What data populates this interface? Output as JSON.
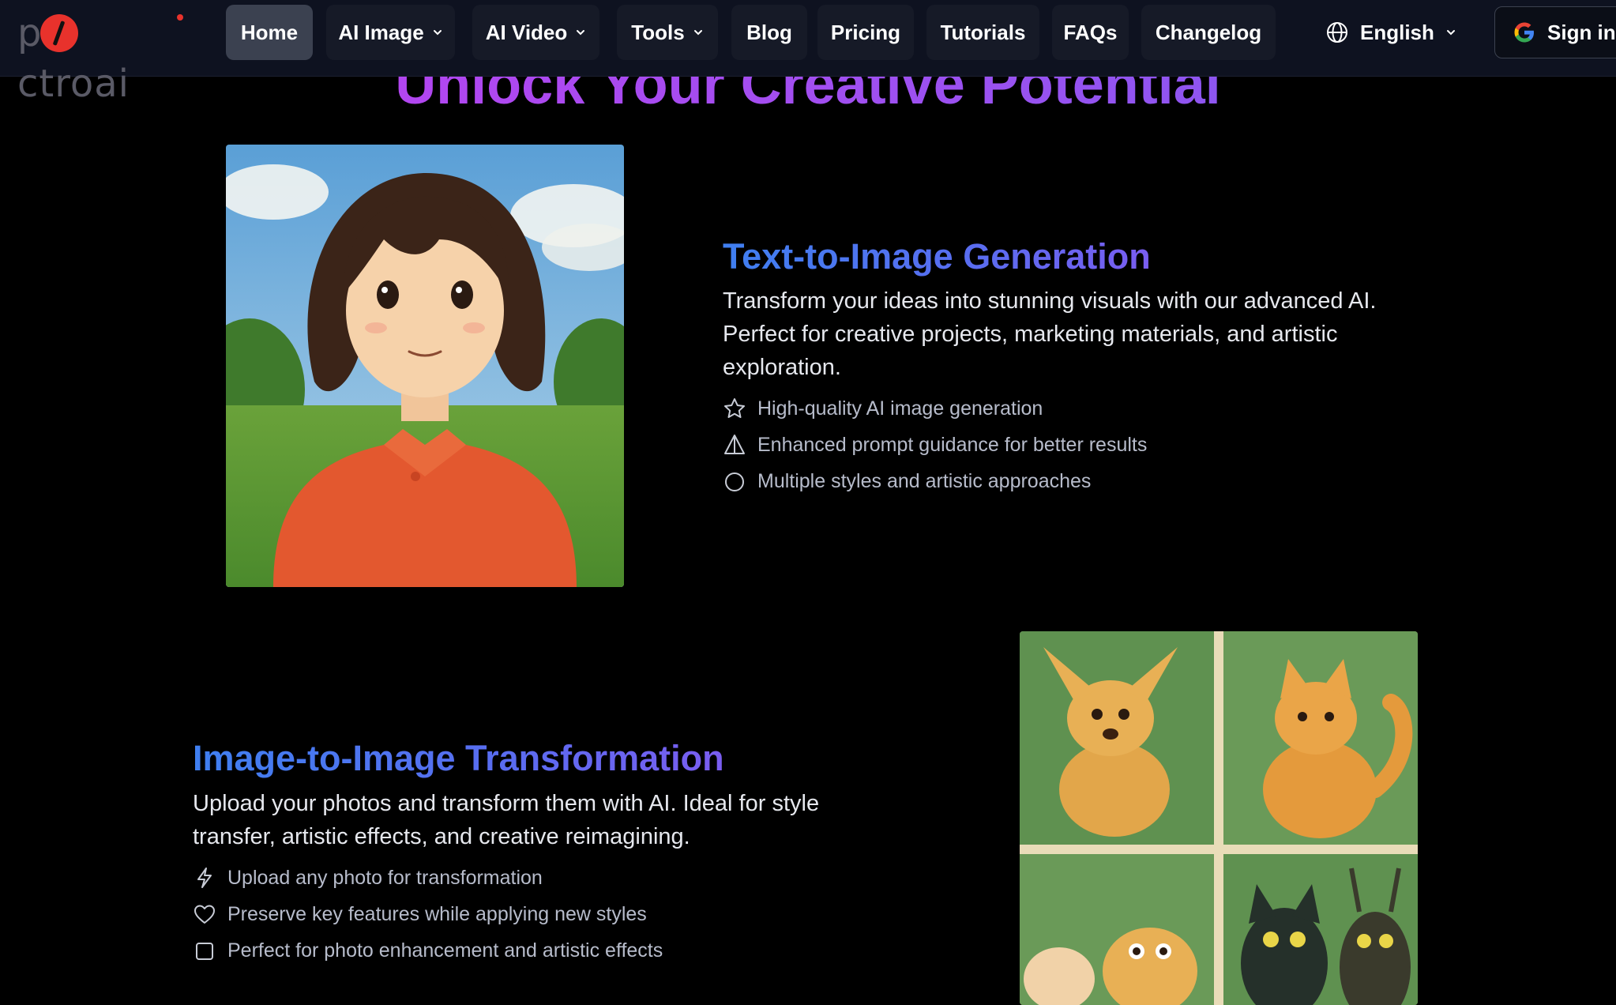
{
  "nav": {
    "logo": "pictroai",
    "items": [
      {
        "label": "Home",
        "active": true,
        "dropdown": false
      },
      {
        "label": "AI Image",
        "active": false,
        "dropdown": true
      },
      {
        "label": "AI Video",
        "active": false,
        "dropdown": true
      },
      {
        "label": "Tools",
        "active": false,
        "dropdown": true
      },
      {
        "label": "Blog",
        "active": false,
        "dropdown": false
      },
      {
        "label": "Pricing",
        "active": false,
        "dropdown": false
      },
      {
        "label": "Tutorials",
        "active": false,
        "dropdown": false
      },
      {
        "label": "FAQs",
        "active": false,
        "dropdown": false
      },
      {
        "label": "Changelog",
        "active": false,
        "dropdown": false
      }
    ],
    "language": "English",
    "signin_label": "Sign in"
  },
  "hero": {
    "title": "Unlock Your Creative Potential"
  },
  "sections": [
    {
      "title": "Text-to-Image Generation",
      "description": "Transform your ideas into stunning visuals with our advanced AI. Perfect for creative projects, marketing materials, and artistic exploration.",
      "features": [
        {
          "icon": "star-icon",
          "text": "High-quality AI image generation"
        },
        {
          "icon": "sail-icon",
          "text": "Enhanced prompt guidance for better results"
        },
        {
          "icon": "circle-icon",
          "text": "Multiple styles and artistic approaches"
        }
      ]
    },
    {
      "title": "Image-to-Image Transformation",
      "description": "Upload your photos and transform them with AI. Ideal for style transfer, artistic effects, and creative reimagining.",
      "features": [
        {
          "icon": "lightning-icon",
          "text": "Upload any photo for transformation"
        },
        {
          "icon": "heart-icon",
          "text": "Preserve key features while applying new styles"
        },
        {
          "icon": "square-icon",
          "text": "Perfect for photo enhancement and artistic effects"
        }
      ]
    }
  ],
  "colors": {
    "nav_bg": "#0e1220",
    "active_tab": "#3b4150",
    "hero_gradient_start": "#c13ef1",
    "hero_gradient_end": "#7b5cf0",
    "section_title": "#4a78f0",
    "logo_accent": "#e8322c"
  }
}
